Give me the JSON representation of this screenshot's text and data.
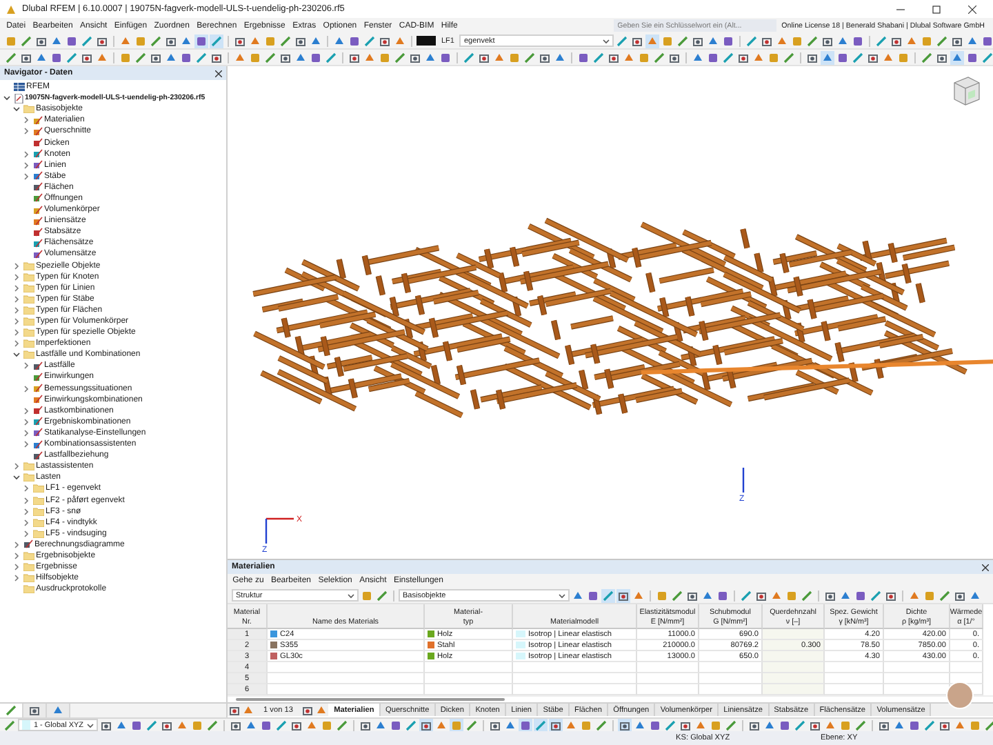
{
  "window": {
    "title": "Dlubal RFEM | 6.10.0007 | 19075N-fagverk-modell-ULS-t-uendelig-ph-230206.rf5"
  },
  "menu": [
    "Datei",
    "Bearbeiten",
    "Ansicht",
    "Einfügen",
    "Zuordnen",
    "Berechnen",
    "Ergebnisse",
    "Extras",
    "Optionen",
    "Fenster",
    "CAD-BIM",
    "Hilfe"
  ],
  "search": {
    "placeholder": "Geben Sie ein Schlüsselwort ein (Alt..."
  },
  "license": "Online License 18 | Benerald Shabani | Dlubal Software GmbH",
  "load_case": {
    "code": "LF1",
    "name": "egenvekt"
  },
  "navigator": {
    "title": "Navigator - Daten",
    "tree": [
      {
        "label": "RFEM",
        "kind": "root"
      },
      {
        "label": "19075N-fagverk-modell-ULS-t-uendelig-ph-230206.rf5",
        "kind": "file",
        "expanded": true,
        "children": [
          {
            "label": "Basisobjekte",
            "kind": "folder",
            "expanded": true,
            "children": [
              {
                "label": "Materialien",
                "kind": "object",
                "expanded": false
              },
              {
                "label": "Querschnitte",
                "kind": "object",
                "expanded": false
              },
              {
                "label": "Dicken",
                "kind": "object"
              },
              {
                "label": "Knoten",
                "kind": "object",
                "expanded": false
              },
              {
                "label": "Linien",
                "kind": "object",
                "expanded": false
              },
              {
                "label": "Stäbe",
                "kind": "object",
                "expanded": false
              },
              {
                "label": "Flächen",
                "kind": "object"
              },
              {
                "label": "Öffnungen",
                "kind": "object"
              },
              {
                "label": "Volumenkörper",
                "kind": "object"
              },
              {
                "label": "Liniensätze",
                "kind": "object"
              },
              {
                "label": "Stabsätze",
                "kind": "object"
              },
              {
                "label": "Flächensätze",
                "kind": "object"
              },
              {
                "label": "Volumensätze",
                "kind": "object"
              }
            ]
          },
          {
            "label": "Spezielle Objekte",
            "kind": "folder",
            "expanded": false
          },
          {
            "label": "Typen für Knoten",
            "kind": "folder",
            "expanded": false
          },
          {
            "label": "Typen für Linien",
            "kind": "folder",
            "expanded": false
          },
          {
            "label": "Typen für Stäbe",
            "kind": "folder",
            "expanded": false
          },
          {
            "label": "Typen für Flächen",
            "kind": "folder",
            "expanded": false
          },
          {
            "label": "Typen für Volumenkörper",
            "kind": "folder",
            "expanded": false
          },
          {
            "label": "Typen für spezielle Objekte",
            "kind": "folder",
            "expanded": false
          },
          {
            "label": "Imperfektionen",
            "kind": "folder",
            "expanded": false
          },
          {
            "label": "Lastfälle und Kombinationen",
            "kind": "folder",
            "expanded": true,
            "children": [
              {
                "label": "Lastfälle",
                "kind": "object",
                "expanded": false
              },
              {
                "label": "Einwirkungen",
                "kind": "object"
              },
              {
                "label": "Bemessungssituationen",
                "kind": "object",
                "expanded": false
              },
              {
                "label": "Einwirkungskombinationen",
                "kind": "object"
              },
              {
                "label": "Lastkombinationen",
                "kind": "object",
                "expanded": false
              },
              {
                "label": "Ergebniskombinationen",
                "kind": "object",
                "expanded": false
              },
              {
                "label": "Statikanalyse-Einstellungen",
                "kind": "object",
                "expanded": false
              },
              {
                "label": "Kombinationsassistenten",
                "kind": "object",
                "expanded": false
              },
              {
                "label": "Lastfallbeziehung",
                "kind": "object"
              }
            ]
          },
          {
            "label": "Lastassistenten",
            "kind": "folder",
            "expanded": false
          },
          {
            "label": "Lasten",
            "kind": "folder",
            "expanded": true,
            "children": [
              {
                "label": "LF1 - egenvekt",
                "kind": "folder",
                "expanded": false
              },
              {
                "label": "LF2 - påført egenvekt",
                "kind": "folder",
                "expanded": false
              },
              {
                "label": "LF3 - snø",
                "kind": "folder",
                "expanded": false
              },
              {
                "label": "LF4 - vindtykk",
                "kind": "folder",
                "expanded": false
              },
              {
                "label": "LF5 - vindsuging",
                "kind": "folder",
                "expanded": false
              }
            ]
          },
          {
            "label": "Berechnungsdiagramme",
            "kind": "object",
            "expanded": false
          },
          {
            "label": "Ergebnisobjekte",
            "kind": "folder",
            "expanded": false
          },
          {
            "label": "Ergebnisse",
            "kind": "folder",
            "expanded": false
          },
          {
            "label": "Hilfsobjekte",
            "kind": "folder",
            "expanded": false
          },
          {
            "label": "Ausdruckprotokolle",
            "kind": "folder"
          }
        ]
      }
    ],
    "tabs": [
      {
        "selected": true
      },
      {
        "selected": false
      },
      {
        "selected": false
      }
    ]
  },
  "triads": [
    {
      "axes": [
        {
          "kind": "x_axis",
          "label": "X"
        },
        {
          "kind": "z_axis",
          "label": "Z"
        }
      ]
    },
    {
      "axes": [
        {
          "kind": "z_axis",
          "label": "Z"
        }
      ]
    }
  ],
  "materials": {
    "title": "Materialien",
    "menu": [
      "Gehe zu",
      "Bearbeiten",
      "Selektion",
      "Ansicht",
      "Einstellungen"
    ],
    "filter": "Struktur",
    "category": "Basisobjekte",
    "columns": [
      [
        "Material",
        "Nr."
      ],
      [
        "Name des Materials"
      ],
      [
        "Material-",
        "typ"
      ],
      [
        "Materialmodell"
      ],
      [
        "Elastizitätsmodul",
        "E [N/mm²]"
      ],
      [
        "Schubmodul",
        "G [N/mm²]"
      ],
      [
        "Querdehnzahl",
        "ν [–]"
      ],
      [
        "Spez. Gewicht",
        "γ [kN/m³]"
      ],
      [
        "Dichte",
        "ρ [kg/m³]"
      ],
      [
        "Wärmede",
        "α [1/°"
      ]
    ],
    "rows": [
      {
        "no": "1",
        "name": "C24",
        "color": "#3a96dd",
        "type": {
          "label": "Holz",
          "color": "#6aa81e"
        },
        "model": "Isotrop | Linear elastisch",
        "e": "11000.0",
        "g": "690.0",
        "gamma": "4.20",
        "rho": "420.00",
        "alpha": "0."
      },
      {
        "no": "2",
        "name": "S355",
        "color": "#8a7460",
        "type": {
          "label": "Stahl",
          "color": "#e0702a"
        },
        "model": "Isotrop | Linear elastisch",
        "e": "210000.0",
        "g": "80769.2",
        "nu": "0.300",
        "gamma": "78.50",
        "rho": "7850.00",
        "alpha": "0."
      },
      {
        "no": "3",
        "name": "GL30c",
        "color": "#c06060",
        "type": {
          "label": "Holz",
          "color": "#6aa81e"
        },
        "model": "Isotrop | Linear elastisch",
        "e": "13000.0",
        "g": "650.0",
        "gamma": "4.30",
        "rho": "430.00",
        "alpha": "0."
      },
      {
        "no": "4"
      },
      {
        "no": "5"
      },
      {
        "no": "6"
      }
    ],
    "pager": "1 von 13",
    "tabs": [
      {
        "label": "Materialien",
        "selected": true
      },
      {
        "label": "Querschnitte",
        "selected": false
      },
      {
        "label": "Dicken",
        "selected": false
      },
      {
        "label": "Knoten",
        "selected": false
      },
      {
        "label": "Linien",
        "selected": false
      },
      {
        "label": "Stäbe",
        "selected": false
      },
      {
        "label": "Flächen",
        "selected": false
      },
      {
        "label": "Öffnungen",
        "selected": false
      },
      {
        "label": "Volumenkörper",
        "selected": false
      },
      {
        "label": "Liniensätze",
        "selected": false
      },
      {
        "label": "Stabsätze",
        "selected": false
      },
      {
        "label": "Flächensätze",
        "selected": false
      },
      {
        "label": "Volumensätze",
        "selected": false
      }
    ]
  },
  "coordinate_system": "1 - Global XYZ",
  "status_bar": [
    "KS: Global XYZ",
    "Ebene: XY"
  ]
}
